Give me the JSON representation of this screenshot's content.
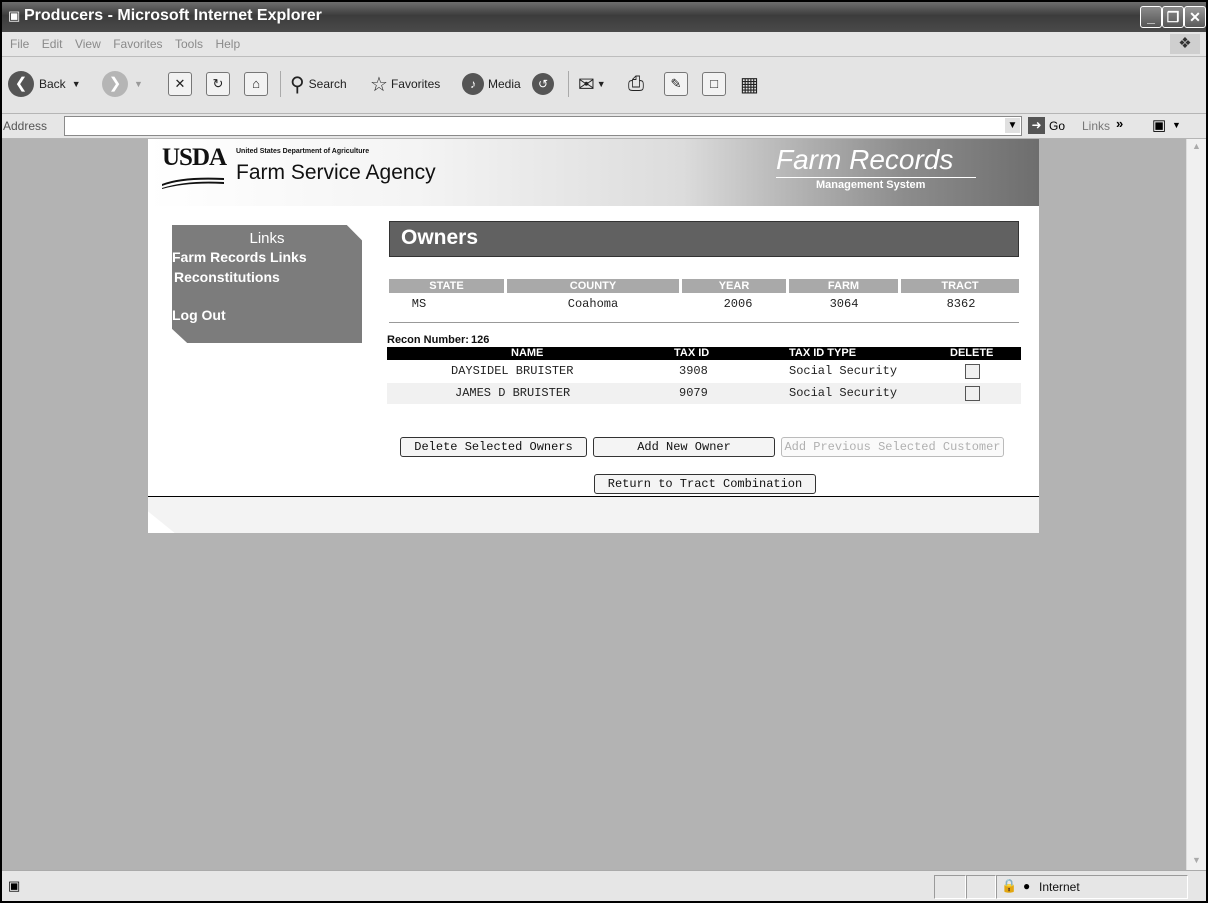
{
  "window": {
    "title": "Producers - Microsoft Internet Explorer"
  },
  "menu": [
    "File",
    "Edit",
    "View",
    "Favorites",
    "Tools",
    "Help"
  ],
  "toolbar": {
    "back": "Back",
    "search": "Search",
    "favorites": "Favorites",
    "media": "Media"
  },
  "address": {
    "label": "Address",
    "value": "",
    "go": "Go",
    "links": "Links"
  },
  "banner": {
    "usda": "USDA",
    "dept": "United States Department of Agriculture",
    "agency": "Farm Service Agency",
    "system_title": "Farm Records",
    "system_subtitle": "Management System"
  },
  "sidebar": {
    "header": "Links",
    "items": [
      {
        "label": "Farm Records Links"
      },
      {
        "label": "Reconstitutions"
      },
      {
        "label": "Log Out"
      }
    ]
  },
  "main": {
    "title": "Owners",
    "summary_headers": [
      "STATE",
      "COUNTY",
      "YEAR",
      "FARM",
      "TRACT"
    ],
    "summary_values": {
      "state": "MS",
      "county": "Coahoma",
      "year": "2006",
      "farm": "3064",
      "tract": "8362"
    },
    "recon_label": "Recon Number:",
    "recon_number": "126",
    "owner_headers": [
      "NAME",
      "TAX ID",
      "TAX ID TYPE",
      "DELETE"
    ],
    "owners": [
      {
        "name": "DAYSIDEL BRUISTER",
        "tax_id": "3908",
        "tax_id_type": "Social Security"
      },
      {
        "name": "JAMES D BRUISTER",
        "tax_id": "9079",
        "tax_id_type": "Social Security"
      }
    ],
    "buttons": {
      "delete_selected": "Delete Selected Owners",
      "add_new": "Add New Owner",
      "add_previous": "Add Previous Selected Customer",
      "return": "Return to Tract Combination"
    }
  },
  "status": {
    "zone": "Internet"
  }
}
